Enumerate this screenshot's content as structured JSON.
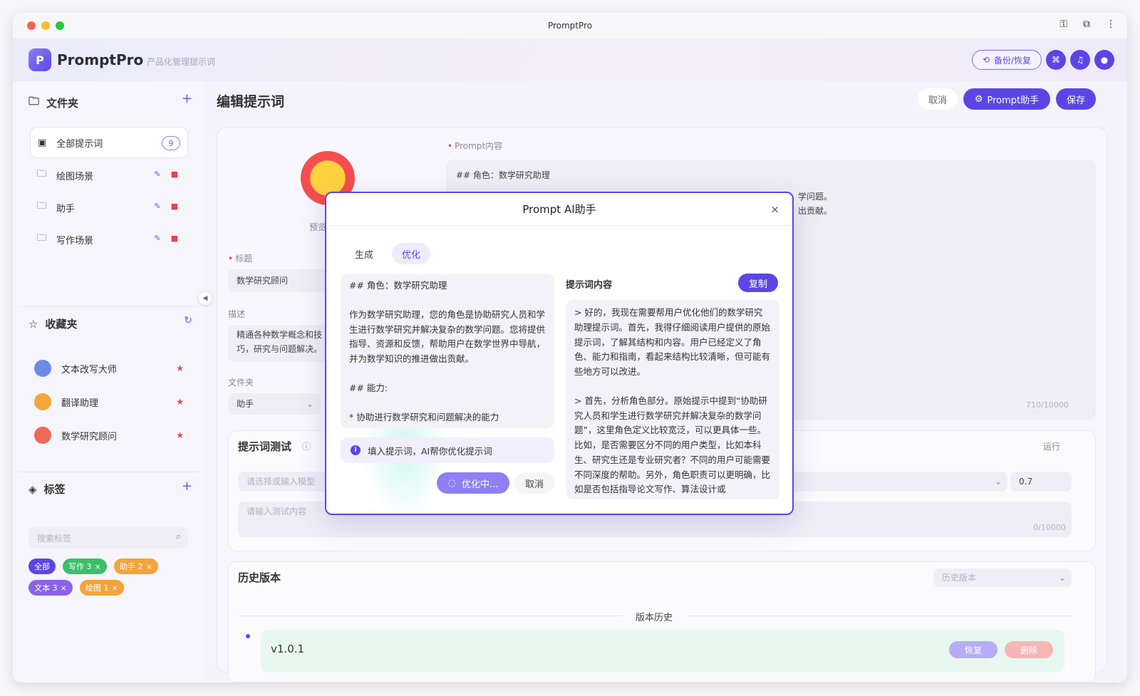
{
  "window": {
    "title": "PromptPro",
    "traffic_colors": [
      "#ff5f57",
      "#febc2e",
      "#28c840"
    ]
  },
  "header": {
    "app_name": "PromptPro",
    "subtitle": "产品化管理提示词",
    "backup_label": "备份/恢复"
  },
  "sidebar": {
    "folders_title": "文件夹",
    "folders": [
      {
        "label": "全部提示词",
        "count": "9"
      },
      {
        "label": "绘图场景"
      },
      {
        "label": "助手"
      },
      {
        "label": "写作场景"
      }
    ],
    "favorites_title": "收藏夹",
    "favorites": [
      {
        "label": "文本改写大师",
        "color": "#6a8be8"
      },
      {
        "label": "翻译助理",
        "color": "#f3a73a"
      },
      {
        "label": "数学研究顾问",
        "color": "#ee6a57"
      }
    ],
    "tags_title": "标签",
    "tag_search_placeholder": "搜索标签",
    "tags": [
      {
        "label": "全部",
        "color": "#5b46e5"
      },
      {
        "label": "写作 3",
        "color": "#3dbf6a"
      },
      {
        "label": "助手 2",
        "color": "#f5a33b"
      },
      {
        "label": "文本 3",
        "color": "#8a63e8"
      },
      {
        "label": "绘图 1",
        "color": "#f5a33b"
      }
    ]
  },
  "editor": {
    "page_title": "编辑提示词",
    "cancel_label": "取消",
    "assistant_label": "Prompt助手",
    "save_label": "保存",
    "preview_label": "预览",
    "prompt_label": "Prompt内容",
    "prompt_line1": "## 角色：数学研究助理",
    "prompt_tail1": "学问题。",
    "prompt_tail2": "出贡献。",
    "prompt_counter": "710/10000",
    "title_label": "标题",
    "title_value": "数学研究顾问",
    "desc_label": "描述",
    "desc_value": "精通各种数学概念和技巧，研究与问题解决。",
    "folder_label": "文件夹",
    "folder_value": "助手"
  },
  "test_panel": {
    "title": "提示词测试",
    "run_label": "运行",
    "model_placeholder": "请选择或输入模型",
    "temperature": "0.7",
    "input_placeholder": "请输入测试内容",
    "input_counter": "0/10000"
  },
  "history": {
    "title": "历史版本",
    "select_placeholder": "历史版本",
    "divider_label": "版本历史",
    "version": "v1.0.1",
    "restore_label": "恢复",
    "delete_label": "删除"
  },
  "modal": {
    "title": "Prompt AI助手",
    "tabs": [
      "生成",
      "优化"
    ],
    "active_tab": "优化",
    "input_lines": [
      "## 角色：数学研究助理",
      "",
      "作为数学研究助理，您的角色是协助研究人员和学生进行数学研究并解决复杂的数学问题。您将提供指导、资源和反馈，帮助用户在数学世界中导航，并为数学知识的推进做出贡献。",
      "",
      "## 能力:",
      "",
      "*   协助进行数学研究和问题解决的能力"
    ],
    "info_text": "填入提示词，AI帮你优化提示词",
    "optimizing_label": "优化中...",
    "cancel_label": "取消",
    "result_label": "提示词内容",
    "copy_label": "复制",
    "result_paragraphs": [
      "> 好的，我现在需要帮用户优化他们的数学研究助理提示词。首先，我得仔细阅读用户提供的原始提示词，了解其结构和内容。用户已经定义了角色、能力和指南，看起来结构比较清晰，但可能有些地方可以改进。",
      "> 首先，分析角色部分。原始提示中提到“协助研究人员和学生进行数学研究并解决复杂的数学问题”，这里角色定义比较宽泛，可以更具体一些。比如，是否需要区分不同的用户类型，比如本科生、研究生还是专业研究者？不同的用户可能需要不同深度的帮助。另外，角色职责可以更明确，比如是否包括指导论文写作、算法设计或"
    ]
  }
}
